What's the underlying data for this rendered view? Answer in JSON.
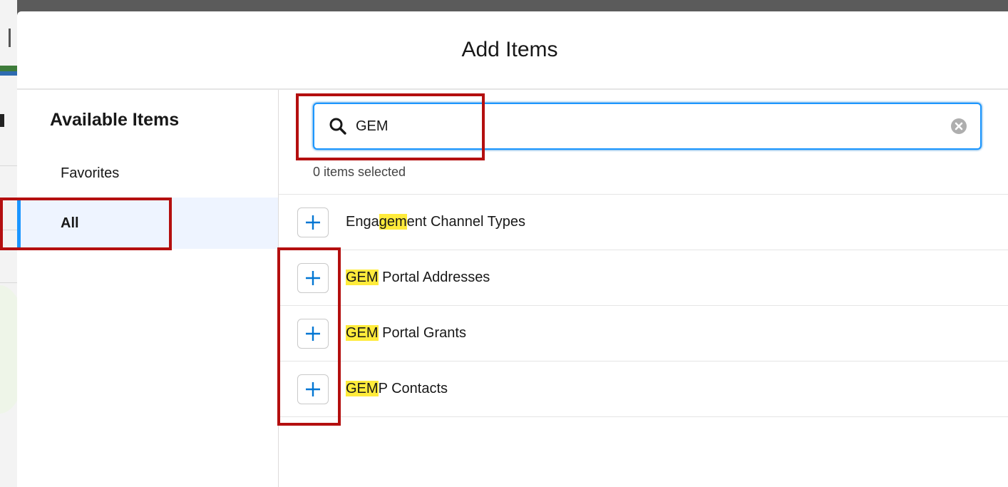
{
  "modal": {
    "title": "Add Items"
  },
  "sidebar": {
    "heading": "Available Items",
    "items": [
      {
        "label": "Favorites",
        "selected": false
      },
      {
        "label": "All",
        "selected": true
      }
    ]
  },
  "search": {
    "value": "GEM",
    "placeholder": "",
    "icon": "search-icon",
    "clear_icon": "clear-icon"
  },
  "selection": {
    "count_text": "0 items selected"
  },
  "results": [
    {
      "pre": "Enga",
      "highlight": "gem",
      "post": "ent Channel Types"
    },
    {
      "pre": "",
      "highlight": "GEM",
      "post": " Portal Addresses"
    },
    {
      "pre": "",
      "highlight": "GEM",
      "post": " Portal Grants"
    },
    {
      "pre": "",
      "highlight": "GEM",
      "post": "P Contacts"
    }
  ],
  "colors": {
    "accent": "#1b96ff",
    "highlight": "#ffeb3b",
    "annotation": "#b40f0f",
    "selected_bg": "#eef4ff"
  }
}
